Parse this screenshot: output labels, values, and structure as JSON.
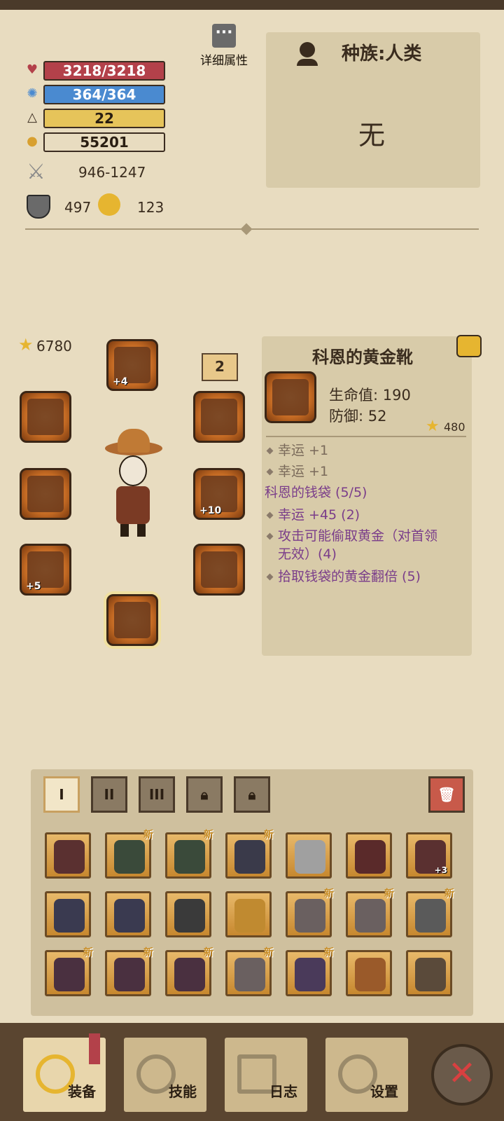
{
  "stats": {
    "hp": "3218/3218",
    "mp": "364/364",
    "level": "22",
    "gold": "55201",
    "attack": "946-1247",
    "defense": "497",
    "luck": "123"
  },
  "detail_button": "详细属性",
  "race_panel": {
    "race": "种族:人类",
    "value": "无"
  },
  "equipment": {
    "score": "6780",
    "helmet_plus": "+4",
    "badge_count": "2",
    "weapon2_plus": "+10",
    "bracer_plus": "+5"
  },
  "item_detail": {
    "name": "科恩的黄金靴",
    "hp": "生命值: 190",
    "defense": "防御: 52",
    "score": "480",
    "bonus1": "幸运 +1",
    "bonus2": "幸运 +1",
    "set_name": "科恩的钱袋 (5/5)",
    "set_bonus1": "幸运 +45 (2)",
    "set_bonus2_line1": "攻击可能偷取黄金（对首领",
    "set_bonus2_line2": "无效）(4)",
    "set_bonus3": "拾取钱袋的黄金翻倍 (5)"
  },
  "tabs": [
    "I",
    "II",
    "III"
  ],
  "inventory": {
    "new_label": "新",
    "plus3": "+3"
  },
  "nav": {
    "equip": "装备",
    "skills": "技能",
    "log": "日志",
    "settings": "设置"
  },
  "colors": {
    "hp": "#b3414a",
    "mp": "#4a8ad0",
    "level": "#e6c45a",
    "gold": "#e8dcc0",
    "set_purple": "#7a3d8a"
  }
}
